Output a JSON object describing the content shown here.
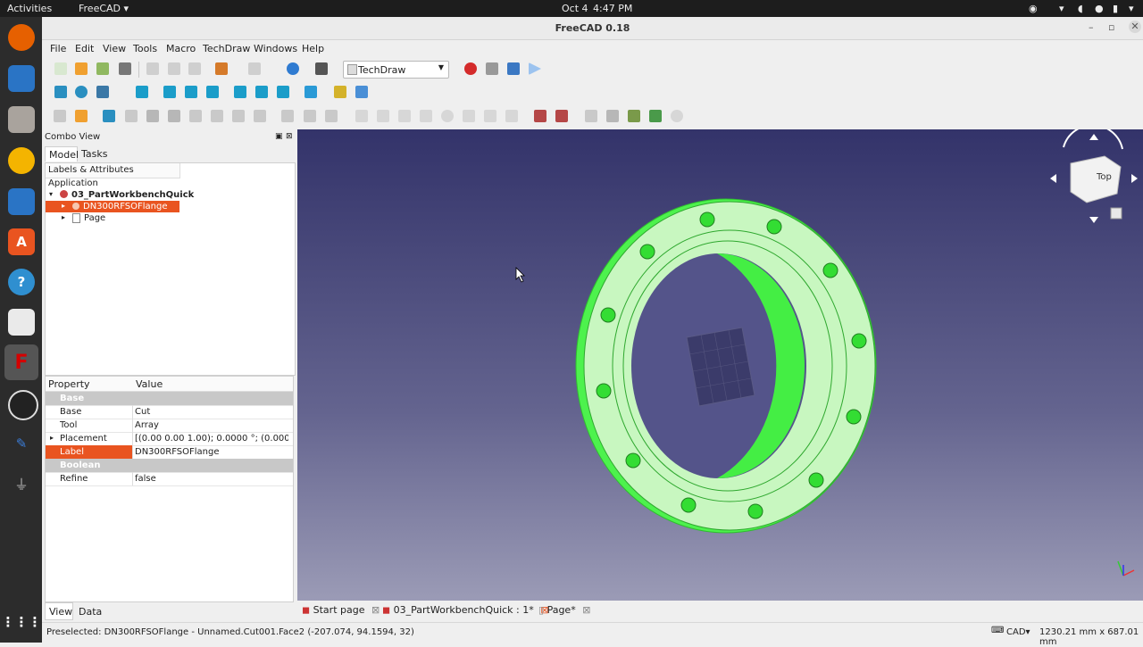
{
  "system_bar": {
    "activities": "Activities",
    "app_menu": "FreeCAD",
    "date": "Oct 4",
    "time": "4:47 PM"
  },
  "window": {
    "title": "FreeCAD 0.18"
  },
  "menubar": [
    "File",
    "Edit",
    "View",
    "Tools",
    "Macro",
    "TechDraw",
    "Windows",
    "Help"
  ],
  "workbench_selector": {
    "value": "TechDraw"
  },
  "combo_view": {
    "title": "Combo View",
    "tabs": [
      "Model",
      "Tasks"
    ],
    "tree_header": "Labels & Attributes",
    "tree_root": "Application",
    "tree": [
      {
        "label": "03_PartWorkbenchQuick",
        "bold": true
      },
      {
        "label": "DN300RFSOFlange",
        "selected": true
      },
      {
        "label": "Page"
      }
    ]
  },
  "property_editor": {
    "headers": [
      "Property",
      "Value"
    ],
    "rows": [
      {
        "type": "group",
        "name": "Base"
      },
      {
        "name": "Base",
        "value": "Cut"
      },
      {
        "name": "Tool",
        "value": "Array"
      },
      {
        "name": "Placement",
        "value": "[(0.00 0.00 1.00); 0.0000 °; (0.0000 ...",
        "expandable": true
      },
      {
        "name": "Label",
        "value": "DN300RFSOFlange",
        "selected": true
      },
      {
        "type": "group",
        "name": "Boolean"
      },
      {
        "name": "Refine",
        "value": "false"
      }
    ],
    "bottom_tabs": [
      "View",
      "Data"
    ]
  },
  "navigation_cube": {
    "face": "Top"
  },
  "document_tabs": [
    "Start page",
    "03_PartWorkbenchQuick : 1*",
    "Page*"
  ],
  "status_bar": {
    "message": "Preselected: DN300RFSOFlange - Unnamed.Cut001.Face2 (-207.074, 94.1594, 32)",
    "nav_style": "CAD",
    "dimensions": "1230.21 mm x 687.01 mm"
  },
  "colors": {
    "accent": "#e95420",
    "flange": "#c8f7c0",
    "flange_edge": "#33dd33"
  }
}
